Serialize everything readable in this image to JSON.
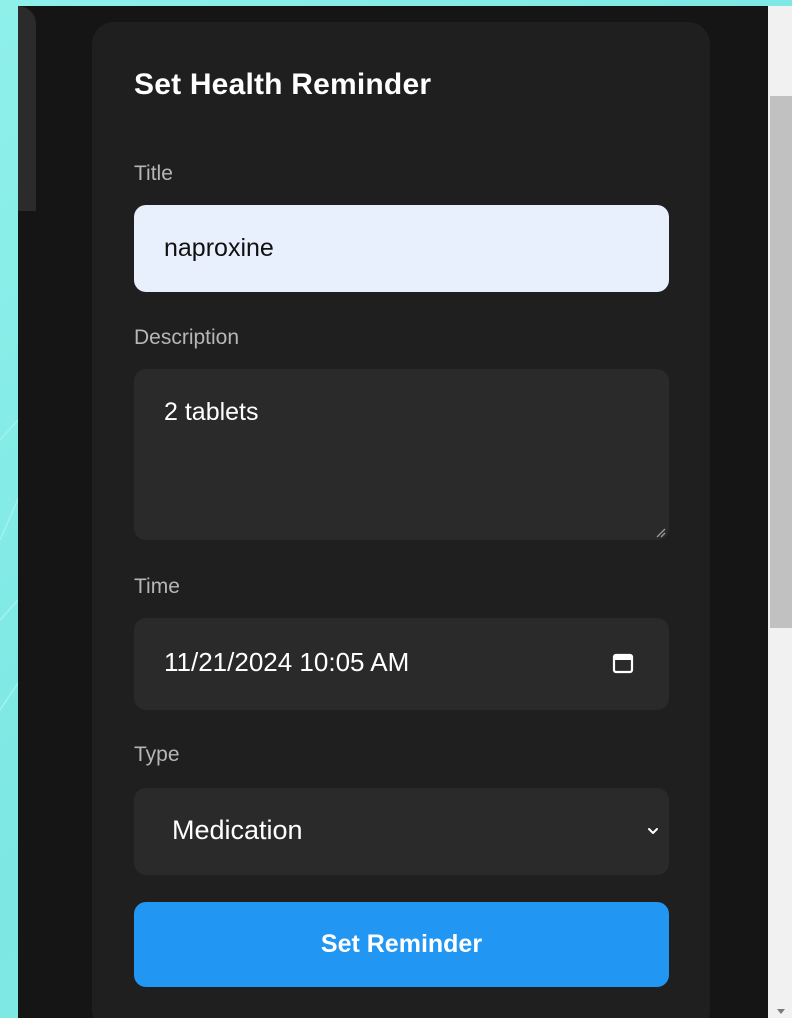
{
  "form": {
    "title": "Set Health Reminder",
    "fields": {
      "title": {
        "label": "Title",
        "value": "naproxine"
      },
      "description": {
        "label": "Description",
        "value": "2 tablets"
      },
      "time": {
        "label": "Time",
        "value": "11/21/2024 10:05 AM"
      },
      "type": {
        "label": "Type",
        "selected": "Medication"
      }
    },
    "submit_label": "Set Reminder"
  },
  "colors": {
    "accent": "#2196f3",
    "card_background": "#1f1f1f",
    "field_background": "#2a2a2a",
    "page_background": "#7fe9e4"
  },
  "icons": {
    "time_picker": "calendar-icon",
    "type_select": "chevron-down-icon",
    "textarea_resize": "resize-grip-icon"
  }
}
